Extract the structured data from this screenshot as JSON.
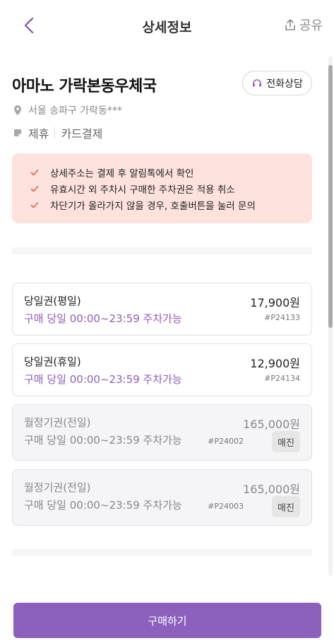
{
  "header": {
    "title": "상세정보",
    "share_label": "공유",
    "back_icon": "chevron-left-icon",
    "share_icon": "share-icon"
  },
  "store": {
    "name": "아마노 가락본동우체국",
    "call_label": "전화상담",
    "address": "서울 송파구 가락동***",
    "tags": [
      "제휴",
      "카드결제"
    ]
  },
  "notice": {
    "items": [
      "상세주소는 결제 후 알림톡에서 확인",
      "유효시간 외 주차시 구매한 주차권은 적용 취소",
      "차단기가 올라가지 않을 경우, 호출버튼을 눌러 문의"
    ]
  },
  "tickets": [
    {
      "name": "당일권(평일)",
      "price": "17,900원",
      "time": "구매 당일 00:00~23:59 주차가능",
      "code": "#P24133",
      "soldout": false
    },
    {
      "name": "당일권(휴일)",
      "price": "12,900원",
      "time": "구매 당일 00:00~23:59 주차가능",
      "code": "#P24134",
      "soldout": false
    },
    {
      "name": "월정기권(전일)",
      "price": "165,000원",
      "time": "구매 당일 00:00~23:59 주차가능",
      "code": "#P24002",
      "soldout": true,
      "badge": "매진"
    },
    {
      "name": "월정기권(전일)",
      "price": "165,000원",
      "time": "구매 당일 00:00~23:59 주차가능",
      "code": "#P24003",
      "soldout": true,
      "badge": "매진"
    }
  ],
  "footer": {
    "buy_label": "구매하기"
  },
  "colors": {
    "accent": "#8b61bd",
    "notice_bg": "#fde2de",
    "check": "#e0604a"
  }
}
